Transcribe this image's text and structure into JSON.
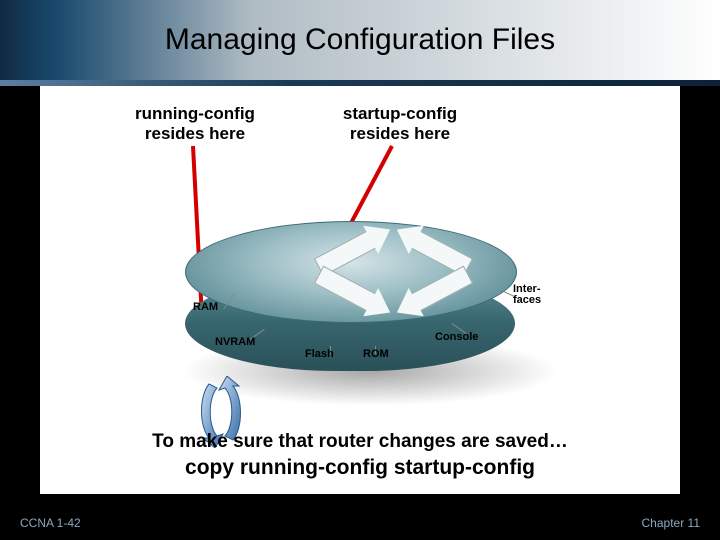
{
  "title": "Managing Configuration Files",
  "labels": {
    "left_line1": "running-config",
    "left_line2": "resides here",
    "right_line1": "startup-config",
    "right_line2": "resides here"
  },
  "router_components": {
    "ram": "RAM",
    "nvram": "NVRAM",
    "flash": "Flash",
    "rom": "ROM",
    "console": "Console",
    "interfaces": "Inter-\nfaces"
  },
  "bottom": {
    "line1": "To make sure that router changes are saved…",
    "line2": "copy running-config startup-config"
  },
  "footer": {
    "left": "CCNA 1-42",
    "right": "Chapter 11"
  },
  "colors": {
    "pointer": "#d40000",
    "router_primary": "#5c8d96"
  }
}
